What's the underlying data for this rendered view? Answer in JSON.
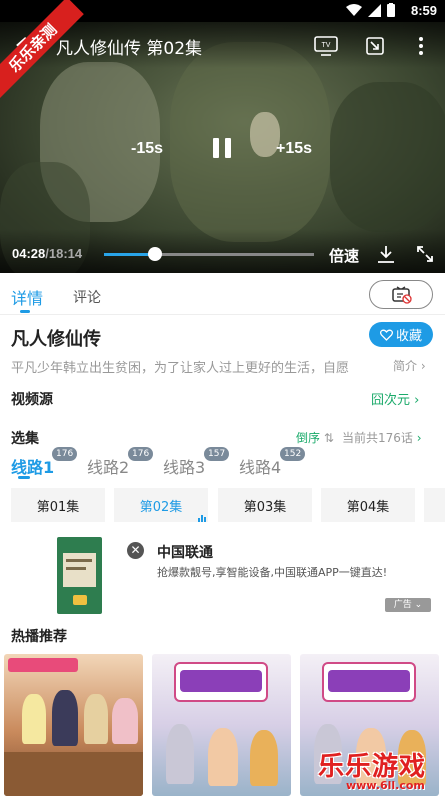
{
  "status_bar": {
    "time": "8:59"
  },
  "player": {
    "title": "凡人修仙传 第02集",
    "rewind_label": "-15s",
    "forward_label": "+15s",
    "current_time": "04:28",
    "total_time": "/18:14",
    "progress": 0.245,
    "speed_label": "倍速",
    "ribbon_label": "乐乐亲测"
  },
  "tabs": {
    "details": "详情",
    "comments": "评论"
  },
  "show": {
    "title": "凡人修仙传",
    "collect_label": "收藏",
    "synopsis": "平凡少年韩立出生贫困，为了让家人过上更好的生活，自愿",
    "synopsis_more": "简介"
  },
  "source": {
    "label": "视频源",
    "value": "囧次元"
  },
  "episodes_section": {
    "label": "选集",
    "sort_label": "倒序",
    "count_label": "当前共176话",
    "lines": [
      {
        "label": "线路1",
        "badge": "176",
        "active": true
      },
      {
        "label": "线路2",
        "badge": "176",
        "active": false
      },
      {
        "label": "线路3",
        "badge": "157",
        "active": false
      },
      {
        "label": "线路4",
        "badge": "152",
        "active": false
      }
    ],
    "episodes": [
      {
        "label": "第01集",
        "active": false
      },
      {
        "label": "第02集",
        "active": true
      },
      {
        "label": "第03集",
        "active": false
      },
      {
        "label": "第04集",
        "active": false
      }
    ]
  },
  "ad": {
    "title": "中国联通",
    "description": "抢爆款靓号,享智能设备,中国联通APP一键直达!",
    "tag": "广告"
  },
  "hot": {
    "label": "热播推荐"
  },
  "watermark": {
    "brand": "乐乐游戏",
    "url": "www.6ll.com"
  },
  "colors": {
    "accent": "#1e9be5",
    "green": "#1aaa6a",
    "ribbon": "#d8201e"
  }
}
